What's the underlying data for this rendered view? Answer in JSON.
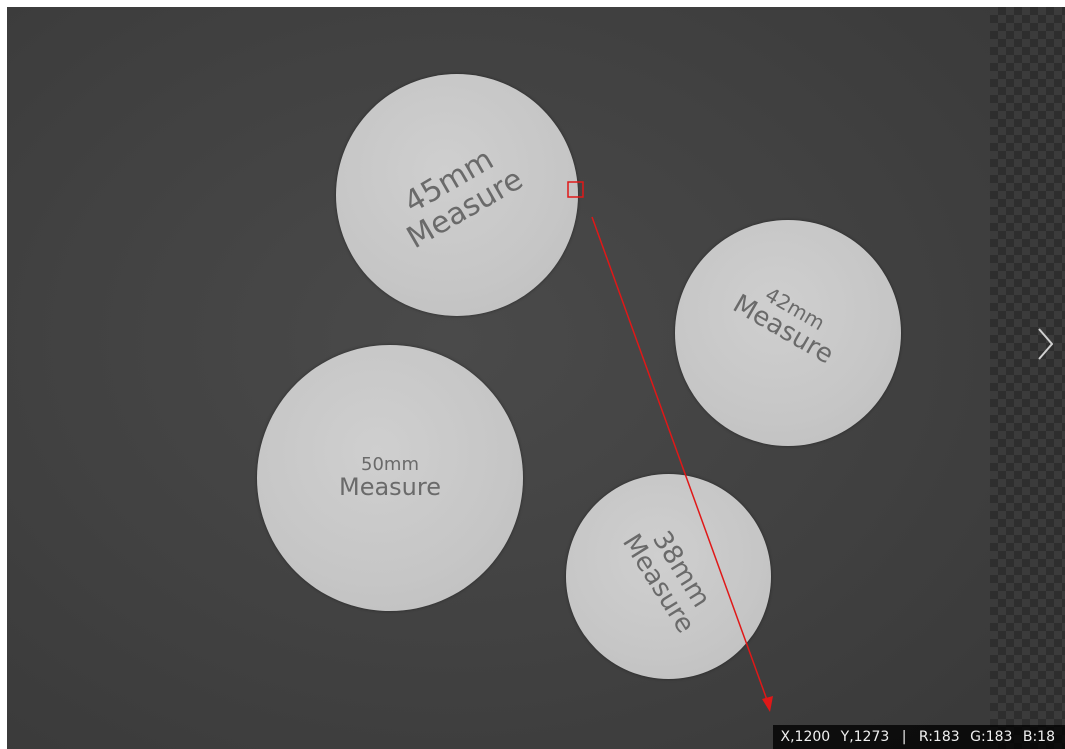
{
  "discs": [
    {
      "size": "45mm",
      "word": "Measure"
    },
    {
      "size": "42mm",
      "word": "Measure"
    },
    {
      "size": "50mm",
      "word": "Measure"
    },
    {
      "size": "38mm",
      "word": "Measure"
    }
  ],
  "status": {
    "x": "X,1200",
    "y": "Y,1273",
    "separator": "|",
    "r": "R:183",
    "g": "G:183",
    "b": "B:18"
  },
  "colors": {
    "measure_line": "#e01818",
    "status_bg": "#000000",
    "status_text": "#f0f0f0"
  },
  "icons": {
    "next": "chevron-right-icon",
    "selection": "selection-square-icon",
    "arrow": "measure-arrow-icon"
  }
}
